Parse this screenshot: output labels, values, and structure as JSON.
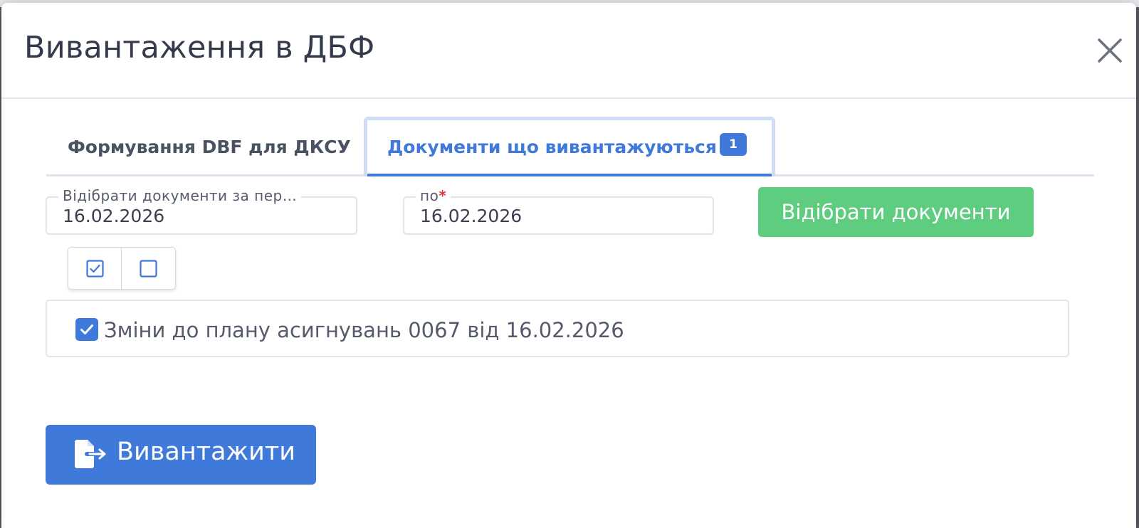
{
  "modal": {
    "title": "Вивантаження в ДБФ",
    "close_icon": "close-icon"
  },
  "tabs": [
    {
      "label": "Формування DBF для ДКСУ",
      "active": false
    },
    {
      "label": "Документи що вивантажуються",
      "active": true,
      "badge": "1"
    }
  ],
  "filters": {
    "from_label": "Відібрати документи за пер…",
    "from_value": "16.02.2026",
    "to_label": "по",
    "to_required_mark": "*",
    "to_value": "16.02.2026",
    "filter_button": "Відібрати документи"
  },
  "select_group": {
    "select_all_icon": "checkbox-checked-icon",
    "deselect_all_icon": "checkbox-empty-icon"
  },
  "documents": [
    {
      "label": "Зміни до плану асигнувань 0067 від 16.02.2026",
      "checked": true
    }
  ],
  "actions": {
    "export_label": "Вивантажити",
    "export_icon": "file-export-icon"
  },
  "colors": {
    "primary": "#3f79d9",
    "success": "#5ecd7f",
    "title": "#343a4b",
    "required": "#d93a3a"
  }
}
